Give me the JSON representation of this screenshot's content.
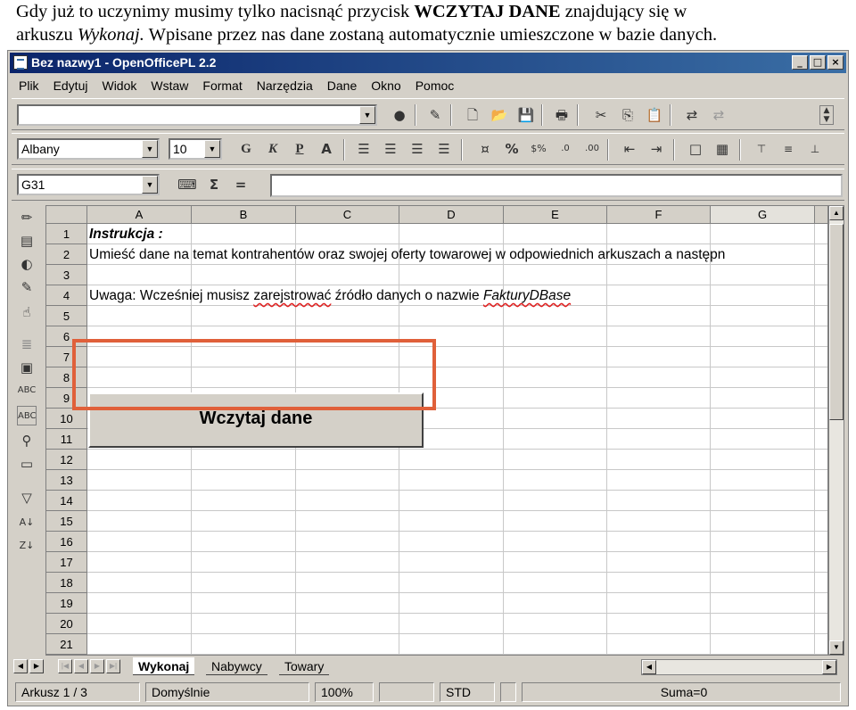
{
  "caption": {
    "line1_pre": "Gdy już to uczynimy musimy tylko nacisnąć przycisk ",
    "line1_bold": "WCZYTAJ DANE",
    "line1_post": " znajdujący się w",
    "line2_pre": "arkuszu ",
    "line2_italic": "Wykonaj.",
    "line2_post": " Wpisane przez nas dane zostaną automatycznie umieszczone w bazie danych."
  },
  "window": {
    "title": "Bez nazwy1 - OpenOfficePL 2.2",
    "btn_min": "_",
    "btn_max": "□",
    "btn_close": "×"
  },
  "menu": {
    "items": [
      "Plik",
      "Edytuj",
      "Widok",
      "Wstaw",
      "Format",
      "Narzędzia",
      "Dane",
      "Okno",
      "Pomoc"
    ]
  },
  "format_bar": {
    "font_name": "Albany",
    "font_size": "10"
  },
  "formula_bar": {
    "cell_ref": "G31",
    "sum_symbol": "Σ",
    "equals_symbol": "="
  },
  "grid": {
    "columns": [
      "A",
      "B",
      "C",
      "D",
      "E",
      "F",
      "G"
    ],
    "rows": [
      "1",
      "2",
      "3",
      "4",
      "5",
      "6",
      "7",
      "8",
      "9",
      "10",
      "11",
      "12",
      "13",
      "14",
      "15",
      "16",
      "17",
      "18",
      "19",
      "20",
      "21"
    ],
    "cells": {
      "r1": "Instrukcja :",
      "r2": "Umieść dane na temat kontrahentów oraz swojej oferty towarowej w odpowiednich arkuszach a następn",
      "r4_pre": "Uwaga: Wcześniej musisz ",
      "r4_squig": "zarejstrować",
      "r4_mid": " źródło danych o nazwie ",
      "r4_italic": "FakturyDBase"
    },
    "form_button_label": "Wczytaj dane"
  },
  "sheet_tabs": {
    "tabs": [
      "Wykonaj",
      "Nabywcy",
      "Towary"
    ],
    "active": "Wykonaj"
  },
  "status_bar": {
    "sheet": "Arkusz 1 / 3",
    "style": "Domyślnie",
    "zoom": "100%",
    "mode": "STD",
    "sum": "Suma=0"
  },
  "colors": {
    "highlight_frame": "#e0603a",
    "title_bar": "#0a246a"
  }
}
